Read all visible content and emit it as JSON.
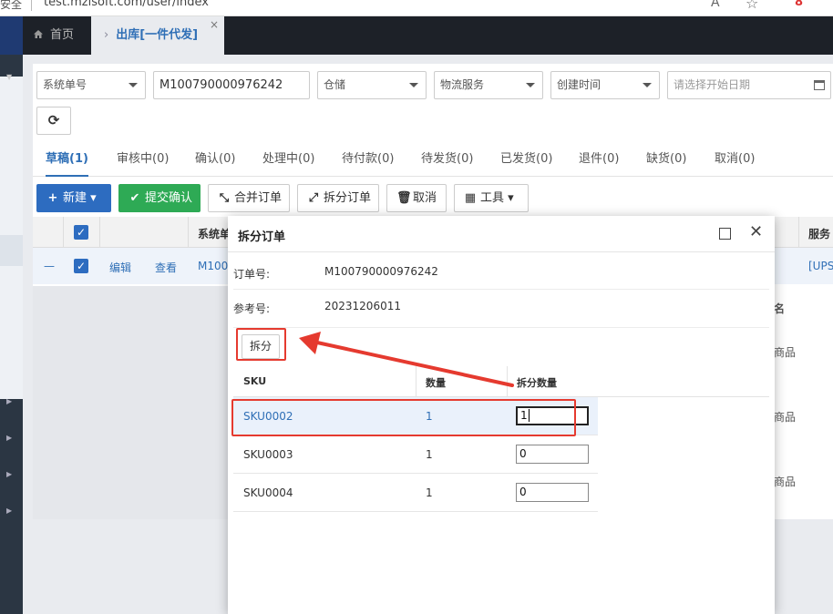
{
  "browser": {
    "security_label": "安全",
    "url": "test.mzlsoft.com/user/index",
    "reader_label": "A",
    "favorite_icon": "star-icon",
    "ext_label": "8"
  },
  "tabs": {
    "home": "首页",
    "active": "出库[一件代发]",
    "close": "×"
  },
  "filters": {
    "field_select": "系统单号",
    "order_value": "M100790000976242",
    "warehouse": "仓储",
    "logistics": "物流服务",
    "time_type": "创建时间",
    "start_date_placeholder": "请选择开始日期"
  },
  "status_tabs": [
    "草稿(1)",
    "审核中(0)",
    "确认(0)",
    "处理中(0)",
    "待付款(0)",
    "待发货(0)",
    "已发货(0)",
    "退件(0)",
    "缺货(0)",
    "取消(0)"
  ],
  "toolbar": {
    "new": "新建",
    "submit": "提交确认",
    "merge": "合并订单",
    "split": "拆分订单",
    "cancel": "取消",
    "tools": "工具"
  },
  "table": {
    "col_system_no": "系统单",
    "col_service": "服务",
    "row_action_edit": "编辑",
    "row_action_view": "查看",
    "row_order_prefix": "M100",
    "row_service": "[UPS",
    "row_dash": "—"
  },
  "background_rows": [
    "商品",
    "商品",
    "商品"
  ],
  "background_header_fragment": "名",
  "modal": {
    "title": "拆分订单",
    "order_no_label": "订单号:",
    "order_no": "M100790000976242",
    "ref_no_label": "参考号:",
    "ref_no": "20231206011",
    "split_button": "拆分",
    "columns": [
      "SKU",
      "数量",
      "拆分数量"
    ],
    "rows": [
      {
        "sku": "SKU0002",
        "qty": "1",
        "split_qty": "1"
      },
      {
        "sku": "SKU0003",
        "qty": "1",
        "split_qty": "0"
      },
      {
        "sku": "SKU0004",
        "qty": "1",
        "split_qty": "0"
      }
    ]
  },
  "colors": {
    "primary": "#2d6cc0",
    "success": "#2eaa55",
    "annotation": "#e53a2f"
  }
}
